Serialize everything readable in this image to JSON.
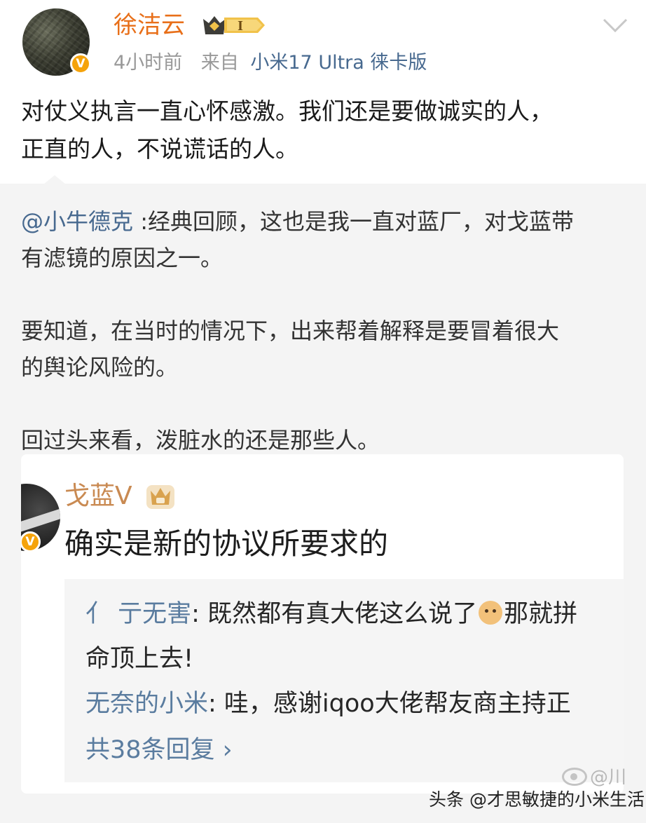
{
  "post": {
    "author": "徐洁云",
    "member_level": "I",
    "time": "4小时前",
    "source_prefix": "来自",
    "source": "小米17 Ultra 徕卡版",
    "line1": "对仗义执言一直心怀感激。我们还是要做诚实的人，",
    "line2": "正直的人，不说谎话的人。"
  },
  "repost": {
    "mention": "@小牛德克",
    "p1_rest_line1": " :经典回顾，这也是我一直对蓝厂，对戈蓝带",
    "p1_line2": "有滤镜的原因之一。",
    "p2_line1": "要知道，在当时的情况下，出来帮着解释是要冒着很大",
    "p2_line2": "的舆论风险的。",
    "p3": "回过头来看，泼脏水的还是那些人。"
  },
  "embedded_card": {
    "name": "戈蓝V",
    "text": "确实是新的协议所要求的",
    "comments": [
      {
        "user": "亍无害",
        "prefix": "亻 ",
        "text_before": ": 既然都有真大佬这么说了",
        "text_after": "那就拼",
        "continuation": "命顶上去!"
      },
      {
        "user": "无奈的小米",
        "text": ": 哇，感谢iqoo大佬帮友商主持正"
      }
    ],
    "more_replies": "共38条回复 ›"
  },
  "watermarks": {
    "weibo": "@川",
    "source": "头条 @才思敏捷的小米生活"
  },
  "icons": {
    "verified": "verified-v-icon",
    "member": "member-crown-badge-icon",
    "chevron": "chevron-down-icon",
    "crown": "crown-icon",
    "emoji": "doge-emoji-icon",
    "weibo": "weibo-logo-icon"
  },
  "colors": {
    "author_name": "#e86f19",
    "link_blue": "#47698f",
    "verified_orange": "#f5a30b",
    "card_name": "#c98a52"
  }
}
